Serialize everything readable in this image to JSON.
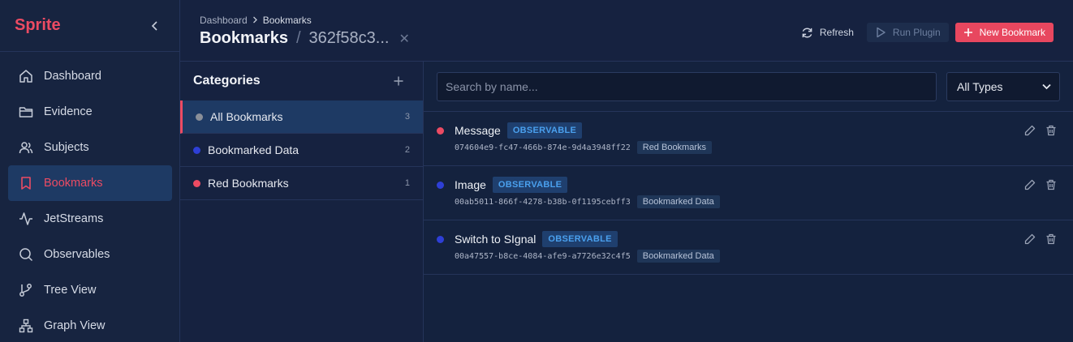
{
  "app": {
    "name": "Sprite"
  },
  "sidebar": {
    "items": [
      {
        "label": "Dashboard",
        "icon": "home-icon"
      },
      {
        "label": "Evidence",
        "icon": "folder-icon"
      },
      {
        "label": "Subjects",
        "icon": "users-icon"
      },
      {
        "label": "Bookmarks",
        "icon": "bookmark-icon",
        "active": true
      },
      {
        "label": "JetStreams",
        "icon": "activity-icon"
      },
      {
        "label": "Observables",
        "icon": "search-icon"
      },
      {
        "label": "Tree View",
        "icon": "git-branch-icon"
      },
      {
        "label": "Graph View",
        "icon": "network-icon"
      }
    ]
  },
  "header": {
    "breadcrumb": [
      "Dashboard",
      "Bookmarks"
    ],
    "title": "Bookmarks",
    "subtitle": "362f58c3...",
    "actions": {
      "refresh": "Refresh",
      "run_plugin": "Run Plugin",
      "new_bookmark": "New Bookmark"
    }
  },
  "categories": {
    "title": "Categories",
    "items": [
      {
        "label": "All Bookmarks",
        "count": "3",
        "color": "#8a8f99"
      },
      {
        "label": "Bookmarked Data",
        "count": "2",
        "color": "#2e3fd6"
      },
      {
        "label": "Red Bookmarks",
        "count": "1",
        "color": "#ec4b63"
      }
    ]
  },
  "filters": {
    "search_placeholder": "Search by name...",
    "type_selected": "All Types"
  },
  "bookmarks": [
    {
      "name": "Message",
      "type": "OBSERVABLE",
      "id": "074604e9-fc47-466b-874e-9d4a3948ff22",
      "category": "Red Bookmarks",
      "color": "#ec4b63"
    },
    {
      "name": "Image",
      "type": "OBSERVABLE",
      "id": "00ab5011-866f-4278-b38b-0f1195cebff3",
      "category": "Bookmarked Data",
      "color": "#2e3fd6"
    },
    {
      "name": "Switch to SIgnal",
      "type": "OBSERVABLE",
      "id": "00a47557-b8ce-4084-afe9-a7726e32c4f5",
      "category": "Bookmarked Data",
      "color": "#2e3fd6"
    }
  ]
}
